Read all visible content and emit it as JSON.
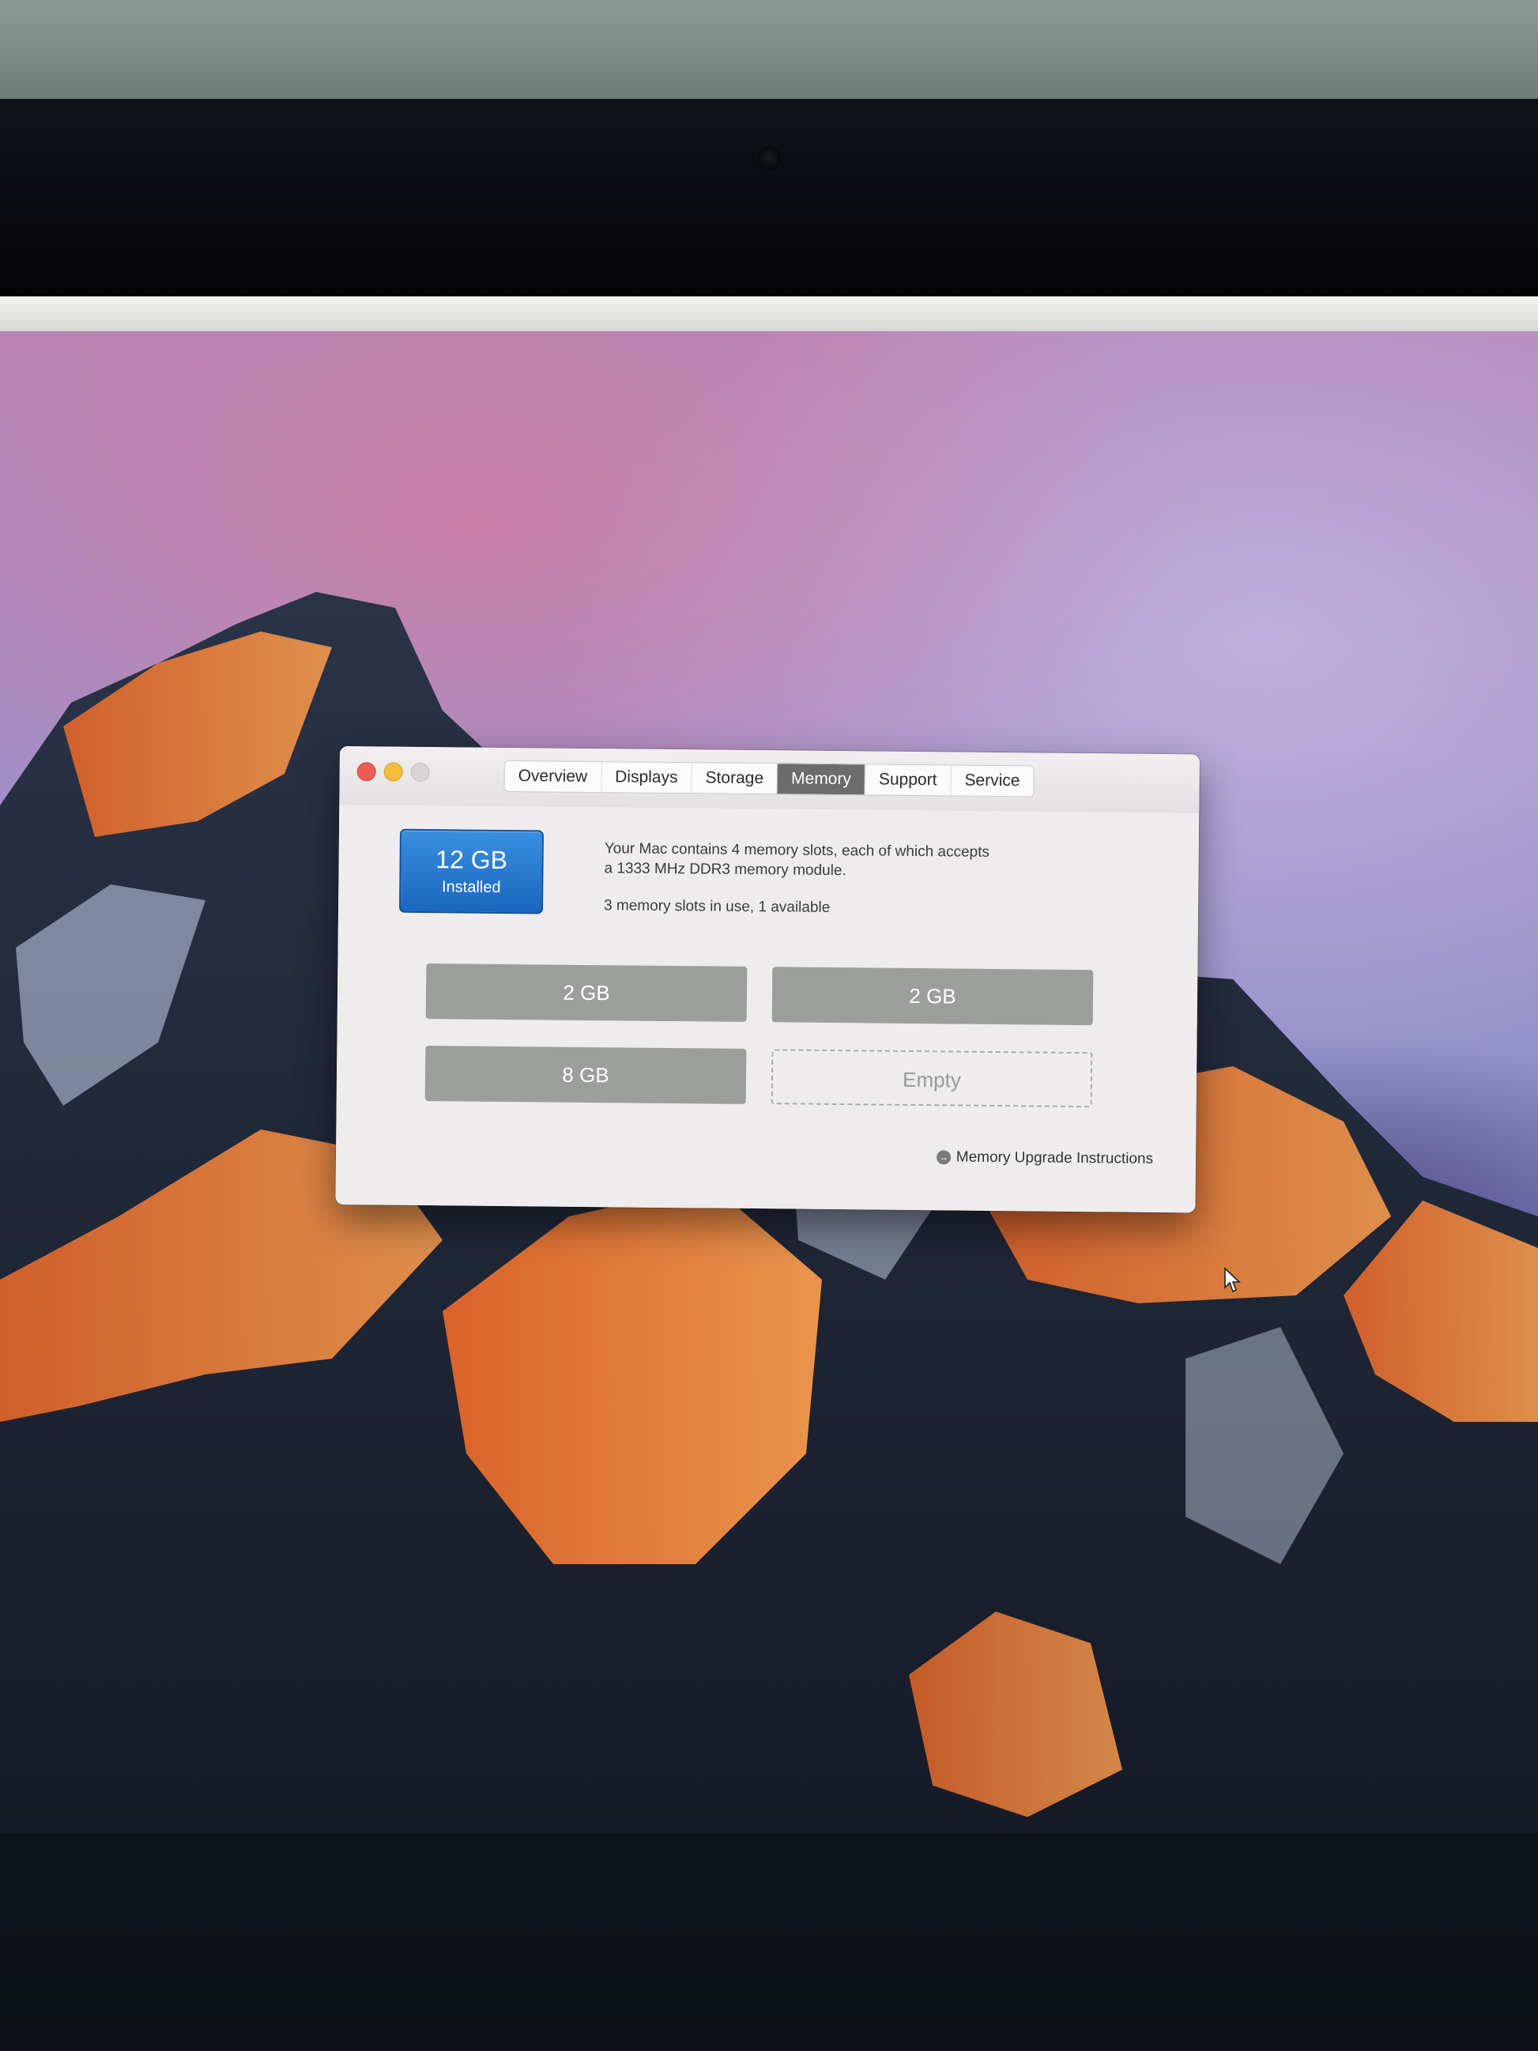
{
  "window": {
    "tabs": [
      {
        "label": "Overview"
      },
      {
        "label": "Displays"
      },
      {
        "label": "Storage"
      },
      {
        "label": "Memory"
      },
      {
        "label": "Support"
      },
      {
        "label": "Service"
      }
    ],
    "active_tab": "Memory"
  },
  "memory": {
    "installed_size": "12 GB",
    "installed_label": "Installed",
    "description_line1": "Your Mac contains 4 memory slots, each of which accepts",
    "description_line2": "a 1333 MHz DDR3 memory module.",
    "usage": "3 memory slots in use, 1 available",
    "slots": [
      {
        "label": "2 GB"
      },
      {
        "label": "2 GB"
      },
      {
        "label": "8 GB"
      },
      {
        "label": "Empty"
      }
    ],
    "upgrade_link": "Memory Upgrade Instructions"
  },
  "colors": {
    "accent": "#1a66c0",
    "close": "#ee5b55",
    "minimize": "#f5bd3c",
    "slot_filled": "#9c9e9c"
  },
  "icons": {
    "link_arrow": "arrow-circle-icon",
    "pointer": "mouse-pointer-icon"
  }
}
